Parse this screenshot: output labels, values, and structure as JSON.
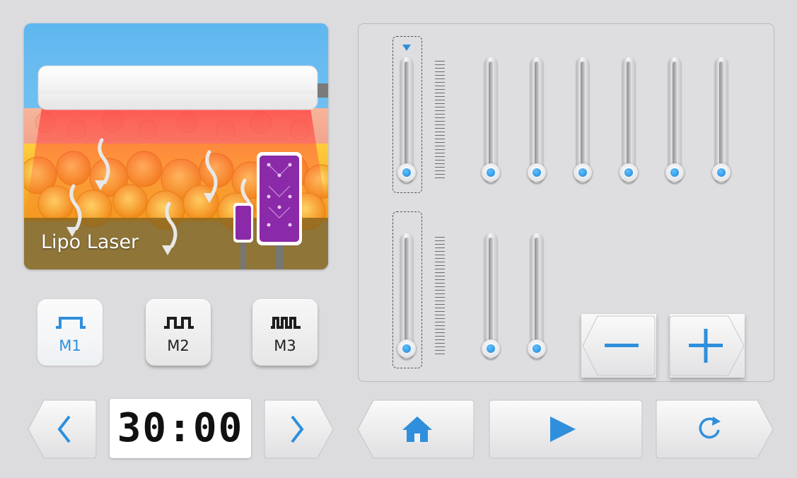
{
  "treatment": {
    "label": "Lipo Laser"
  },
  "modes": [
    {
      "label": "M1",
      "active": true,
      "icon": "single-pulse-icon"
    },
    {
      "label": "M2",
      "active": false,
      "icon": "double-pulse-icon"
    },
    {
      "label": "M3",
      "active": false,
      "icon": "triple-pulse-icon"
    }
  ],
  "timer": {
    "value": "30:00"
  },
  "sliders": {
    "row1_count": 7,
    "row2_count": 3,
    "levels": [
      0,
      0,
      0,
      0,
      0,
      0,
      0,
      0,
      0,
      0
    ]
  },
  "colors": {
    "accent": "#2f8fdc",
    "background": "#dcdcdf"
  },
  "icons": {
    "decrease": "minus-icon",
    "increase": "plus-icon",
    "prev": "chevron-left-icon",
    "next": "chevron-right-icon",
    "home": "home-icon",
    "start": "play-icon",
    "reset": "refresh-icon"
  }
}
